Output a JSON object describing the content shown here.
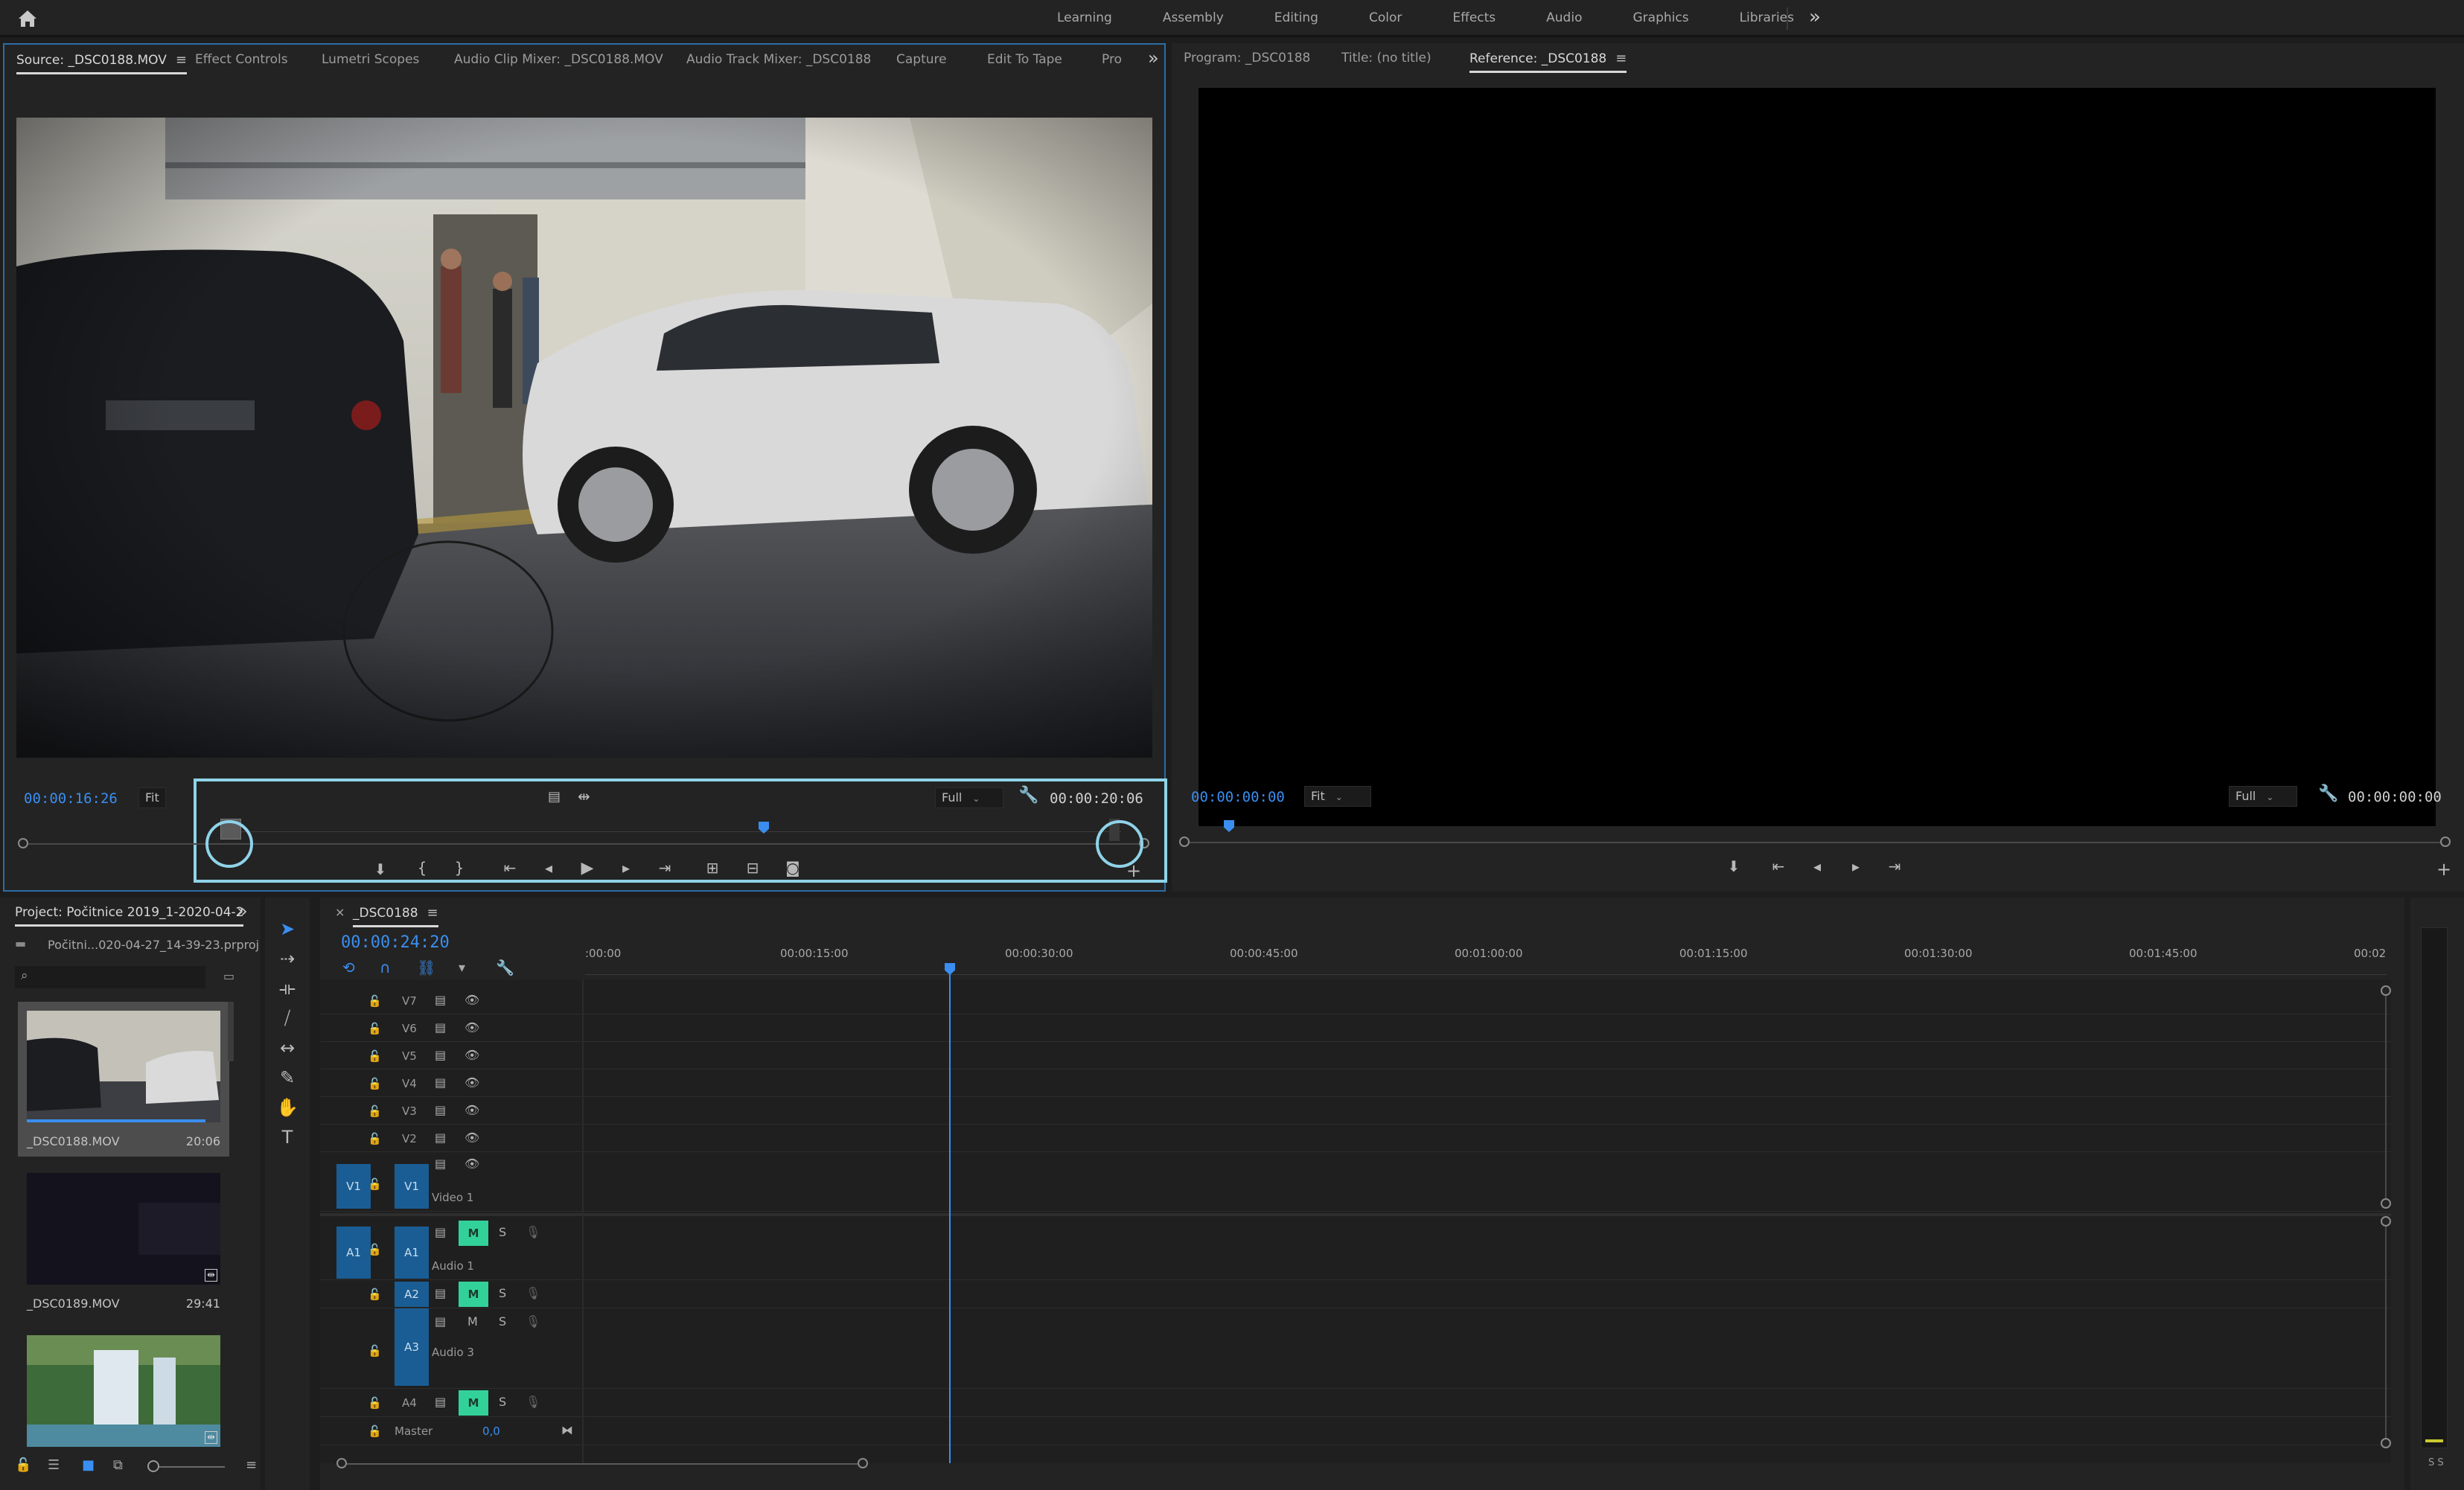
{
  "workspace_tabs": [
    "Learning",
    "Assembly",
    "Editing",
    "Color",
    "Effects",
    "Audio",
    "Graphics",
    "Libraries"
  ],
  "source_panel": {
    "tabs": [
      "Source: _DSC0188.MOV",
      "Effect Controls",
      "Lumetri Scopes",
      "Audio Clip Mixer: _DSC0188.MOV",
      "Audio Track Mixer: _DSC0188",
      "Capture",
      "Edit To Tape",
      "Pro"
    ],
    "timecode_in": "00:00:16:26",
    "fit": "Fit",
    "quality": "Full",
    "timecode_out": "00:00:20:06",
    "playhead_fraction": 0.6
  },
  "program_panel": {
    "tabs": [
      "Program: _DSC0188",
      "Title: (no title)",
      "Reference: _DSC0188"
    ],
    "timecode_in": "00:00:00:00",
    "fit": "Fit",
    "quality": "Full",
    "timecode_out": "00:00:00:00"
  },
  "project_panel": {
    "title": "Project: Počitnice 2019_1-2020-04-2",
    "project_file": "Počitni...020-04-27_14-39-23.prproj",
    "items": [
      {
        "name": "_DSC0188.MOV",
        "duration": "20:06"
      },
      {
        "name": "_DSC0189.MOV",
        "duration": "29:41"
      },
      {
        "name": "",
        "duration": ""
      }
    ]
  },
  "timeline": {
    "sequence_name": "_DSC0188",
    "timecode": "00:00:24:20",
    "ruler_labels": [
      ":00:00",
      "00:00:15:00",
      "00:00:30:00",
      "00:00:45:00",
      "00:01:00:00",
      "00:01:15:00",
      "00:01:30:00",
      "00:01:45:00",
      "00:02"
    ],
    "video_tracks": [
      {
        "id": "V7"
      },
      {
        "id": "V6"
      },
      {
        "id": "V5"
      },
      {
        "id": "V4"
      },
      {
        "id": "V3"
      },
      {
        "id": "V2"
      },
      {
        "id": "V1",
        "name": "Video 1",
        "source": "V1"
      }
    ],
    "audio_tracks": [
      {
        "id": "A1",
        "name": "Audio 1",
        "source": "A1"
      },
      {
        "id": "A2"
      },
      {
        "id": "A3",
        "name": "Audio 3"
      },
      {
        "id": "A4"
      }
    ],
    "mute_label": "M",
    "solo_label": "S",
    "master_label": "Master",
    "master_value": "0,0"
  },
  "meter": {
    "labels": "S S"
  },
  "colors": {
    "accent_blue": "#3a8ef0",
    "track_target": "#1a5d94",
    "mute_green": "#33d19a",
    "highlight": "#8fd3e8"
  }
}
